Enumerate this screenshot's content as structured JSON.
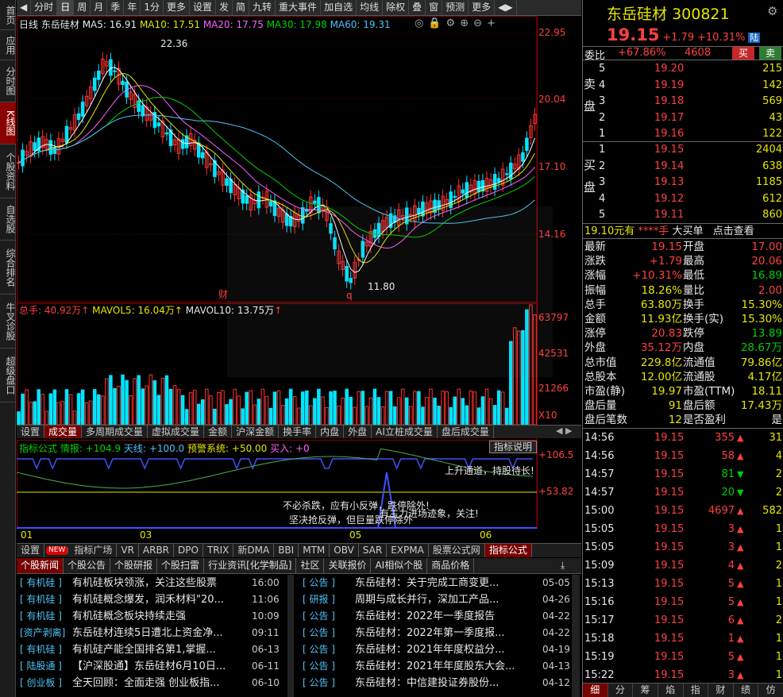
{
  "left_sidebar": [
    "首页",
    "应用",
    "分时图",
    "K线图",
    "个股资料",
    "自选股",
    "综合排名",
    "牛叉诊股",
    "超级盘口"
  ],
  "toolbar": [
    "分时",
    "日",
    "周",
    "月",
    "季",
    "年",
    "1分",
    "更多",
    "设置",
    "发",
    "简",
    "九转",
    "重大事件",
    "加自选",
    "均线",
    "除权",
    "叠",
    "窗",
    "预测",
    "更多"
  ],
  "toolbar_active": "日",
  "legend": {
    "period": "日线",
    "name": "东岳硅材",
    "ma5": "MA5: 16.91",
    "ma10": "MA10: 17.51",
    "ma20": "MA20: 17.75",
    "ma30": "MA30: 17.98",
    "ma60": "MA60: 19.31"
  },
  "price_axis": [
    "22.95",
    "20.04",
    "17.10",
    "14.16"
  ],
  "annotations": {
    "high": "22.36",
    "low": "11.80",
    "cai": "财",
    "q": "q"
  },
  "vol_legend": {
    "total": "总手: 40.92万",
    "mavol5": "MAVOL5: 16.04万",
    "mavol10": "MAVOL10: 13.75万"
  },
  "vol_axis": [
    "63797",
    "42531",
    "21266",
    "X10"
  ],
  "tabs_mid": [
    "设置",
    "成交量",
    "多周期成交量",
    "虚拟成交量",
    "金额",
    "沪深金额",
    "换手率",
    "内盘",
    "外盘",
    "AI立桩成交量",
    "盘后成交量"
  ],
  "tabs_mid_active": "成交量",
  "ind_legend": {
    "name": "指标公式 情报: +104.9",
    "tian": "天线: +100.0",
    "yj": "预警系统: +50.00",
    "mr": "买入: +0"
  },
  "ind_button": "指标说明",
  "ind_axis": [
    "+106.5",
    "+53.82"
  ],
  "ind_texts": {
    "up": "上升通道，持股待长!",
    "t1": "不必杀跌，应有小反弹，跌停除外!",
    "t2": "坚决抢反弹，但巨量跌停除外",
    "t3": "有主力进场迹象，关注!"
  },
  "months": [
    "01",
    "03",
    "05",
    "06"
  ],
  "tabs_ind": [
    "设置",
    "NEW",
    "指标广场",
    "VR",
    "ARBR",
    "DPO",
    "TRIX",
    "新DMA",
    "BBI",
    "MTM",
    "OBV",
    "SAR",
    "EXPMA",
    "股票公式网",
    "指标公式"
  ],
  "tabs_ind_active": "指标公式",
  "news_tabs": [
    "个股新闻",
    "个股公告",
    "个股研报",
    "个股扫雷",
    "行业资讯[化学制品]",
    "社区",
    "关联报价",
    "AI相似个股",
    "商品价格"
  ],
  "news_left": [
    {
      "tag": "[ 有机硅 ]",
      "title": "有机硅板块领涨，关注这些股票",
      "time": "16:00"
    },
    {
      "tag": "[ 有机硅 ]",
      "title": "有机硅概念爆发，润禾材料\"20...",
      "time": "11:06"
    },
    {
      "tag": "[ 有机硅 ]",
      "title": "有机硅概念板块持续走强",
      "time": "10:09"
    },
    {
      "tag": "[资产剥离]",
      "title": "东岳硅材连续5日遭北上资金净...",
      "time": "09:11"
    },
    {
      "tag": "[ 有机硅 ]",
      "title": "有机硅产能全国排名第1,掌握...",
      "time": "06-13"
    },
    {
      "tag": "[ 陆股通 ]",
      "title": "【沪深股通】东岳硅材6月10日...",
      "time": "06-11"
    },
    {
      "tag": "[ 创业板 ]",
      "title": "全天回顾：全面走强 创业板指...",
      "time": "06-10"
    }
  ],
  "news_right": [
    {
      "tag": "[ 公告 ]",
      "title": "东岳硅材：关于完成工商变更...",
      "time": "05-05"
    },
    {
      "tag": "[ 研报 ]",
      "title": "周期与成长并行，深加工产品...",
      "time": "04-26"
    },
    {
      "tag": "[ 公告 ]",
      "title": "东岳硅材：2022年一季度报告",
      "time": "04-22"
    },
    {
      "tag": "[ 公告 ]",
      "title": "东岳硅材：2022年第一季度报...",
      "time": "04-22"
    },
    {
      "tag": "[ 公告 ]",
      "title": "东岳硅材：2021年年度权益分...",
      "time": "04-19"
    },
    {
      "tag": "[ 公告 ]",
      "title": "东岳硅材：2021年年度股东大会...",
      "time": "04-13"
    },
    {
      "tag": "[ 公告 ]",
      "title": "东岳硅材：中信建投证券股份...",
      "time": "04-12"
    }
  ],
  "quote": {
    "name": "东岳硅材",
    "code": "300821",
    "price": "19.15",
    "chg": "+1.79",
    "pct": "+10.31%",
    "badge": "陆",
    "weibi_label": "委比",
    "weibi": "+67.86%",
    "weicha": "4608",
    "buy": "买",
    "sell": "卖"
  },
  "asks": [
    [
      "5",
      "19.20",
      "215"
    ],
    [
      "4",
      "19.19",
      "142"
    ],
    [
      "3",
      "19.18",
      "569"
    ],
    [
      "2",
      "19.17",
      "43"
    ],
    [
      "1",
      "19.16",
      "122"
    ]
  ],
  "ask_label": [
    "卖",
    "盘"
  ],
  "bids": [
    [
      "1",
      "19.15",
      "2404"
    ],
    [
      "2",
      "19.14",
      "638"
    ],
    [
      "3",
      "19.13",
      "1185"
    ],
    [
      "4",
      "19.12",
      "612"
    ],
    [
      "5",
      "19.11",
      "860"
    ]
  ],
  "bid_label": [
    "买",
    "盘"
  ],
  "bigorder": {
    "a": "19.10元有",
    "b": "****手",
    "c": "大买单",
    "d": "点击查看"
  },
  "stats": [
    [
      "最新",
      "19.15",
      "开盘",
      "17.00"
    ],
    [
      "涨跌",
      "+1.79",
      "最高",
      "20.06"
    ],
    [
      "涨幅",
      "+10.31%",
      "最低",
      "16.89"
    ],
    [
      "振幅",
      "18.26%",
      "量比",
      "2.00"
    ],
    [
      "总手",
      "63.80万",
      "换手",
      "15.30%"
    ],
    [
      "金额",
      "11.93亿",
      "换手(实)",
      "15.30%"
    ],
    [
      "涨停",
      "20.83",
      "跌停",
      "13.89"
    ],
    [
      "外盘",
      "35.12万",
      "内盘",
      "28.67万"
    ],
    [
      "总市值",
      "229.8亿",
      "流通值",
      "79.86亿"
    ],
    [
      "总股本",
      "12.00亿",
      "流通股",
      "4.17亿"
    ],
    [
      "市盈(静)",
      "19.97",
      "市盈(TTM)",
      "18.11"
    ],
    [
      "盘后量",
      "91",
      "盘后额",
      "17.43万"
    ],
    [
      "盘后笔数",
      "12",
      "是否盈利",
      "是"
    ]
  ],
  "ticks": [
    [
      "14:56",
      "19.15",
      "355",
      "up",
      "31"
    ],
    [
      "14:56",
      "19.15",
      "58",
      "up",
      "4"
    ],
    [
      "14:57",
      "19.15",
      "81",
      "down",
      "2"
    ],
    [
      "14:57",
      "19.15",
      "20",
      "down",
      "2"
    ],
    [
      "15:00",
      "19.15",
      "4697",
      "up",
      "582"
    ],
    [
      "15:05",
      "19.15",
      "3",
      "up",
      "1"
    ],
    [
      "15:05",
      "19.15",
      "3",
      "up",
      "1"
    ],
    [
      "15:09",
      "19.15",
      "4",
      "up",
      "2"
    ],
    [
      "15:13",
      "19.15",
      "5",
      "up",
      "1"
    ],
    [
      "15:16",
      "19.15",
      "5",
      "up",
      "1"
    ],
    [
      "15:17",
      "19.15",
      "6",
      "up",
      "2"
    ],
    [
      "15:18",
      "19.15",
      "1",
      "up",
      "1"
    ],
    [
      "15:19",
      "19.15",
      "5",
      "up",
      "1"
    ],
    [
      "15:22",
      "19.15",
      "3",
      "up",
      "1"
    ]
  ],
  "bottom_tabs": [
    "细",
    "分",
    "筹",
    "焰",
    "指",
    "财",
    "绩",
    "仿"
  ],
  "bottom_tabs_active": "细",
  "colors": {
    "up": "#ff3030",
    "down": "#00e5ff",
    "ma5": "#ffffff",
    "ma10": "#e6e600",
    "ma20": "#ff60ff",
    "ma30": "#00d000",
    "ma60": "#4fc3f7"
  }
}
